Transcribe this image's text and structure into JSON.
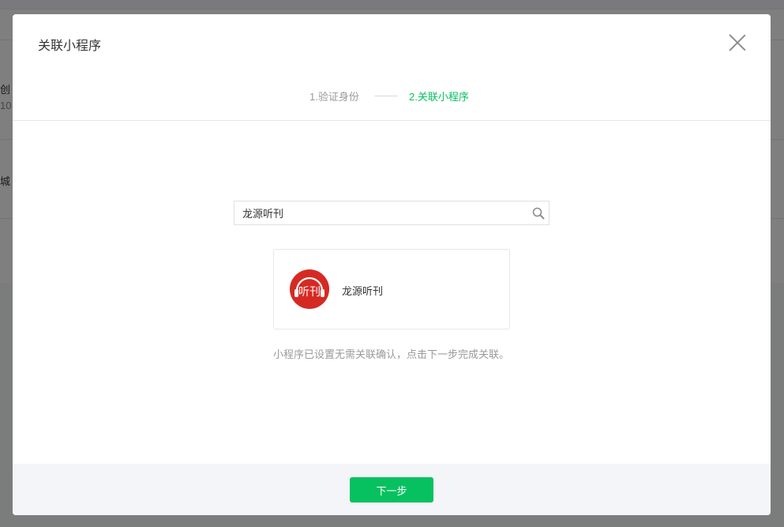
{
  "background": {
    "row1_label": "创",
    "row1_value": "10",
    "row2_label": "城"
  },
  "dialog": {
    "title": "关联小程序",
    "steps": [
      {
        "label": "1.验证身份",
        "state": "done"
      },
      {
        "label": "2.关联小程序",
        "state": "active"
      }
    ],
    "search": {
      "value": "龙源听刊",
      "placeholder": ""
    },
    "result": {
      "name": "龙源听刊",
      "logo_text": "听刊",
      "logo_color": "#d52a23"
    },
    "hint": "小程序已设置无需关联确认，点击下一步完成关联。",
    "next_button": "下一步"
  },
  "colors": {
    "accent": "#07c160",
    "overlay": "rgba(0,0,0,0.5)",
    "footer_bg": "#f4f5f9"
  }
}
